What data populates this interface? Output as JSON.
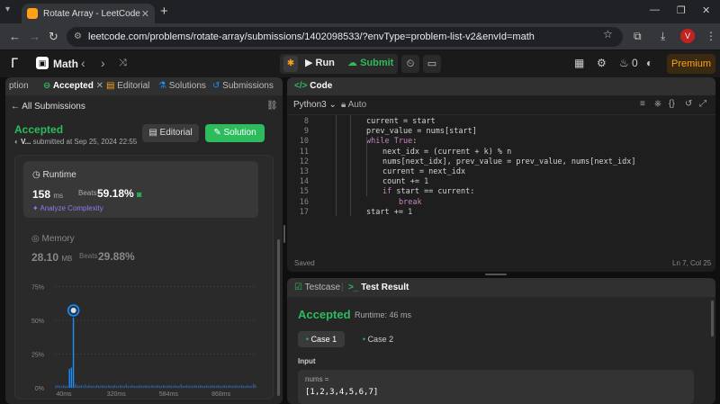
{
  "browser": {
    "tab_title": "Rotate Array - LeetCode",
    "url": "leetcode.com/problems/rotate-array/submissions/1402098533/?envType=problem-list-v2&envId=math",
    "profile_initial": "V"
  },
  "topbar": {
    "problem_list": "Math",
    "run_label": "Run",
    "submit_label": "Submit",
    "streak_count": "0",
    "premium_label": "Premium"
  },
  "left_tabs": [
    {
      "label": "ption"
    },
    {
      "label": "Accepted"
    },
    {
      "label": "Editorial"
    },
    {
      "label": "Solutions"
    },
    {
      "label": "Submissions"
    }
  ],
  "submission": {
    "back_label": "All Submissions",
    "status": "Accepted",
    "user": "V...",
    "submitted_text": "submitted at Sep 25, 2024 22:55",
    "editorial_btn": "Editorial",
    "solution_btn": "Solution"
  },
  "runtime": {
    "title": "Runtime",
    "value": "158",
    "unit": "ms",
    "beats_label": "Beats",
    "beats_pct": "59.18%",
    "analyze_label": "Analyze Complexity"
  },
  "memory": {
    "title": "Memory",
    "value": "28.10",
    "unit": "MB",
    "beats_label": "Beats",
    "beats_pct": "29.88%"
  },
  "chart_data": {
    "type": "bar",
    "title": "",
    "xlabel": "",
    "ylabel": "",
    "ytick_labels": [
      "75%",
      "50%",
      "25%",
      "0%"
    ],
    "yticks": [
      75,
      50,
      25,
      0
    ],
    "xtick_labels": [
      "40ms",
      "320ms",
      "584ms",
      "868ms"
    ],
    "ylim": [
      0,
      80
    ],
    "grid": true,
    "colors": {
      "bar": "#1a90ff",
      "bar_faded": "#2b5c8f"
    },
    "highlight_index": 9,
    "values": [
      1.5,
      2,
      1.5,
      1.5,
      2,
      1.5,
      1.5,
      14,
      15,
      52,
      3,
      2,
      1.5,
      2,
      1.5,
      2.5,
      1.5,
      2,
      1.5,
      1.5,
      1.5,
      2,
      1.5,
      1.5,
      2,
      1.5,
      1.5,
      2,
      1.5,
      1.5,
      2,
      1.5,
      1.5,
      2,
      1.5,
      1.5,
      2.5,
      1.5,
      1.5,
      2,
      1.5,
      1.5,
      1.5,
      2,
      1.5,
      1.5,
      2,
      1.5,
      1.5,
      2,
      1.5,
      1.5,
      2,
      1.5,
      1.5,
      2,
      1.5,
      1.5,
      2,
      1.5,
      1.5,
      2,
      1.5,
      1.5,
      2.5,
      1.5,
      1.5,
      2,
      1.5,
      1.5,
      1.5,
      2,
      1.5,
      1.5,
      2,
      1.5,
      1.5,
      2,
      1.5,
      1.5,
      2,
      1.5,
      1.5,
      2,
      1.5,
      1.5,
      2,
      1.5,
      1.5,
      2,
      1.5,
      1.5,
      2,
      1.5,
      1.5,
      2,
      1.5,
      1.5,
      2,
      1.5,
      1.5,
      3,
      2
    ]
  },
  "code_panel": {
    "title": "Code",
    "language": "Python3",
    "mode": "Auto",
    "status": "Saved",
    "cursor": "Ln 7, Col 25",
    "lines": [
      {
        "n": "8",
        "indent": 0,
        "parts": [
          [
            "t",
            "current = start"
          ]
        ]
      },
      {
        "n": "9",
        "indent": 0,
        "parts": [
          [
            "t",
            "prev_value = nums[start]"
          ]
        ]
      },
      {
        "n": "10",
        "indent": 0,
        "parts": [
          [
            "k",
            "while"
          ],
          [
            "t",
            " "
          ],
          [
            "k",
            "True"
          ],
          [
            "t",
            ":"
          ]
        ]
      },
      {
        "n": "11",
        "indent": 1,
        "parts": [
          [
            "t",
            "next_idx = (current + k) % n"
          ]
        ]
      },
      {
        "n": "12",
        "indent": 1,
        "parts": [
          [
            "t",
            "nums[next_idx], prev_value = prev_value, nums[next_idx]"
          ]
        ]
      },
      {
        "n": "13",
        "indent": 1,
        "parts": [
          [
            "t",
            "current = next_idx"
          ]
        ]
      },
      {
        "n": "14",
        "indent": 1,
        "parts": [
          [
            "t",
            "count += "
          ],
          [
            "n",
            "1"
          ]
        ]
      },
      {
        "n": "15",
        "indent": 1,
        "parts": [
          [
            "k",
            "if"
          ],
          [
            "t",
            " start == current:"
          ]
        ]
      },
      {
        "n": "16",
        "indent": 2,
        "parts": [
          [
            "k",
            "break"
          ]
        ]
      },
      {
        "n": "17",
        "indent": 0,
        "parts": [
          [
            "t",
            "start += "
          ],
          [
            "n",
            "1"
          ]
        ]
      }
    ]
  },
  "result_panel": {
    "tab_testcase": "Testcase",
    "tab_result": "Test Result",
    "status": "Accepted",
    "runtime_text": "Runtime: 46 ms",
    "case1": "Case 1",
    "case2": "Case 2",
    "input_label": "Input",
    "input_var": "nums =",
    "input_value": "[1,2,3,4,5,6,7]"
  }
}
